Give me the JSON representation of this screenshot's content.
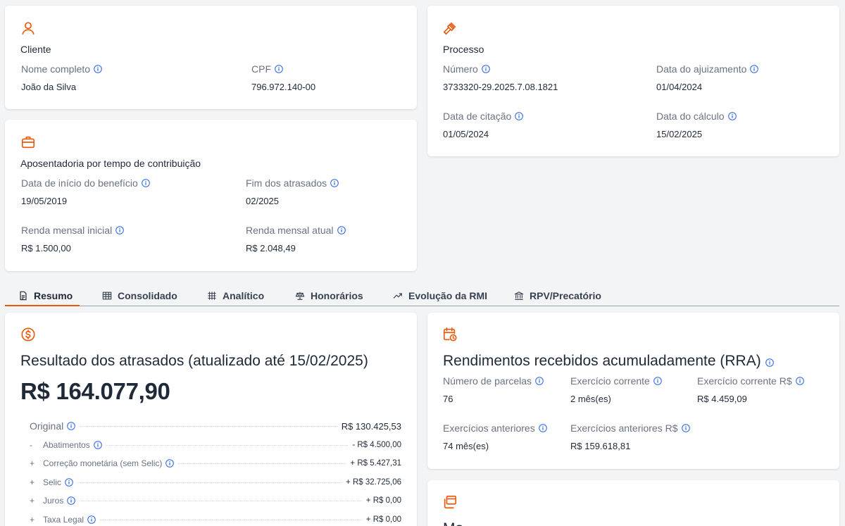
{
  "cliente": {
    "title": "Cliente",
    "nome_label": "Nome completo",
    "nome_value": "João da Silva",
    "cpf_label": "CPF",
    "cpf_value": "796.972.140-00"
  },
  "processo": {
    "title": "Processo",
    "numero_label": "Número",
    "numero_value": "3733320-29.2025.7.08.1821",
    "ajuizamento_label": "Data do ajuizamento",
    "ajuizamento_value": "01/04/2024",
    "citacao_label": "Data de citação",
    "citacao_value": "01/05/2024",
    "calculo_label": "Data do cálculo",
    "calculo_value": "15/02/2025"
  },
  "beneficio": {
    "title": "Aposentadoria por tempo de contribuição",
    "inicio_label": "Data de início do benefício",
    "inicio_value": "19/05/2019",
    "fim_label": "Fim dos atrasados",
    "fim_value": "02/2025",
    "renda_inicial_label": "Renda mensal inicial",
    "renda_inicial_value": "R$ 1.500,00",
    "renda_atual_label": "Renda mensal atual",
    "renda_atual_value": "R$ 2.048,49"
  },
  "tabs": [
    {
      "label": "Resumo"
    },
    {
      "label": "Consolidado"
    },
    {
      "label": "Analítico"
    },
    {
      "label": "Honorários"
    },
    {
      "label": "Evolução da RMI"
    },
    {
      "label": "RPV/Precatório"
    }
  ],
  "resultado": {
    "title": "Resultado dos atrasados (atualizado até 15/02/2025)",
    "amount": "R$ 164.077,90",
    "original_label": "Original",
    "original_value": "R$ 130.425,53",
    "items": [
      {
        "sign": "-",
        "label": "Abatimentos",
        "value": "- R$ 4.500,00"
      },
      {
        "sign": "+",
        "label": "Correção monetária (sem Selic)",
        "value": "+ R$ 5.427,31"
      },
      {
        "sign": "+",
        "label": "Selic",
        "value": "+ R$ 32.725,06"
      },
      {
        "sign": "+",
        "label": "Juros",
        "value": "+ R$ 0,00"
      },
      {
        "sign": "+",
        "label": "Taxa Legal",
        "value": "+ R$ 0,00"
      }
    ]
  },
  "rra": {
    "title": "Rendimentos recebidos acumuladamente (RRA)",
    "parcelas_label": "Número de parcelas",
    "parcelas_value": "76",
    "exercicio_label": "Exercício corrente",
    "exercicio_value": "2 mês(es)",
    "exercicio_rs_label": "Exercício corrente R$",
    "exercicio_rs_value": "R$ 4.459,09",
    "anteriores_label": "Exercícios anteriores",
    "anteriores_value": "74 mês(es)",
    "anteriores_rs_label": "Exercícios anteriores R$",
    "anteriores_rs_value": "R$ 159.618,81"
  },
  "bottom_card": {
    "title_partial": "Mo"
  },
  "colors": {
    "accent": "#ea580c",
    "info": "#2563eb",
    "label": "#6b7280",
    "text": "#1f2937"
  }
}
